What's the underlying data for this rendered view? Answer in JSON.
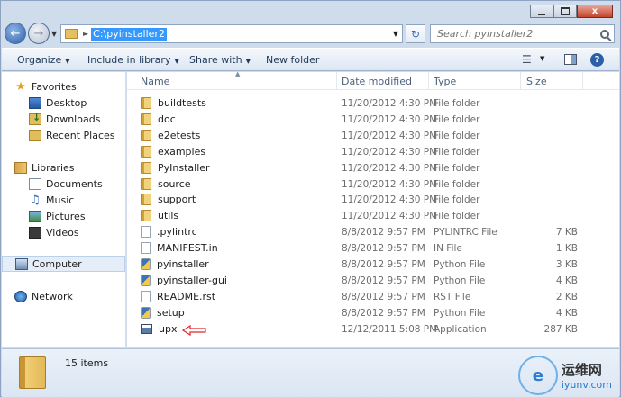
{
  "window": {
    "minimize_label": "",
    "maximize_label": "",
    "close_label": "x"
  },
  "address": {
    "path": "C:\\pyinstaller2",
    "search_placeholder": "Search pyinstaller2"
  },
  "toolbar": {
    "organize": "Organize",
    "include": "Include in library",
    "share": "Share with",
    "new_folder": "New folder"
  },
  "nav": {
    "favorites": "Favorites",
    "desktop": "Desktop",
    "downloads": "Downloads",
    "recent": "Recent Places",
    "libraries": "Libraries",
    "documents": "Documents",
    "music": "Music",
    "pictures": "Pictures",
    "videos": "Videos",
    "computer": "Computer",
    "network": "Network"
  },
  "columns": {
    "name": "Name",
    "date": "Date modified",
    "type": "Type",
    "size": "Size"
  },
  "files": [
    {
      "name": "buildtests",
      "date": "11/20/2012 4:30 PM",
      "type": "File folder",
      "size": "",
      "icon": "folder"
    },
    {
      "name": "doc",
      "date": "11/20/2012 4:30 PM",
      "type": "File folder",
      "size": "",
      "icon": "folder"
    },
    {
      "name": "e2etests",
      "date": "11/20/2012 4:30 PM",
      "type": "File folder",
      "size": "",
      "icon": "folder"
    },
    {
      "name": "examples",
      "date": "11/20/2012 4:30 PM",
      "type": "File folder",
      "size": "",
      "icon": "folder"
    },
    {
      "name": "PyInstaller",
      "date": "11/20/2012 4:30 PM",
      "type": "File folder",
      "size": "",
      "icon": "folder"
    },
    {
      "name": "source",
      "date": "11/20/2012 4:30 PM",
      "type": "File folder",
      "size": "",
      "icon": "folder"
    },
    {
      "name": "support",
      "date": "11/20/2012 4:30 PM",
      "type": "File folder",
      "size": "",
      "icon": "folder"
    },
    {
      "name": "utils",
      "date": "11/20/2012 4:30 PM",
      "type": "File folder",
      "size": "",
      "icon": "folder"
    },
    {
      "name": ".pylintrc",
      "date": "8/8/2012 9:57 PM",
      "type": "PYLINTRC File",
      "size": "7 KB",
      "icon": "file"
    },
    {
      "name": "MANIFEST.in",
      "date": "8/8/2012 9:57 PM",
      "type": "IN File",
      "size": "1 KB",
      "icon": "file"
    },
    {
      "name": "pyinstaller",
      "date": "8/8/2012 9:57 PM",
      "type": "Python File",
      "size": "3 KB",
      "icon": "py"
    },
    {
      "name": "pyinstaller-gui",
      "date": "8/8/2012 9:57 PM",
      "type": "Python File",
      "size": "4 KB",
      "icon": "py"
    },
    {
      "name": "README.rst",
      "date": "8/8/2012 9:57 PM",
      "type": "RST File",
      "size": "2 KB",
      "icon": "file"
    },
    {
      "name": "setup",
      "date": "8/8/2012 9:57 PM",
      "type": "Python File",
      "size": "4 KB",
      "icon": "py"
    },
    {
      "name": "upx",
      "date": "12/12/2011 5:08 PM",
      "type": "Application",
      "size": "287 KB",
      "icon": "app"
    }
  ],
  "status": {
    "count": "15 items"
  },
  "watermark": {
    "cn": "运维网",
    "en": "iyunv.com",
    "logo": "e"
  },
  "colors": {
    "selection": "#3399ff",
    "annotation": "#e0262b"
  }
}
